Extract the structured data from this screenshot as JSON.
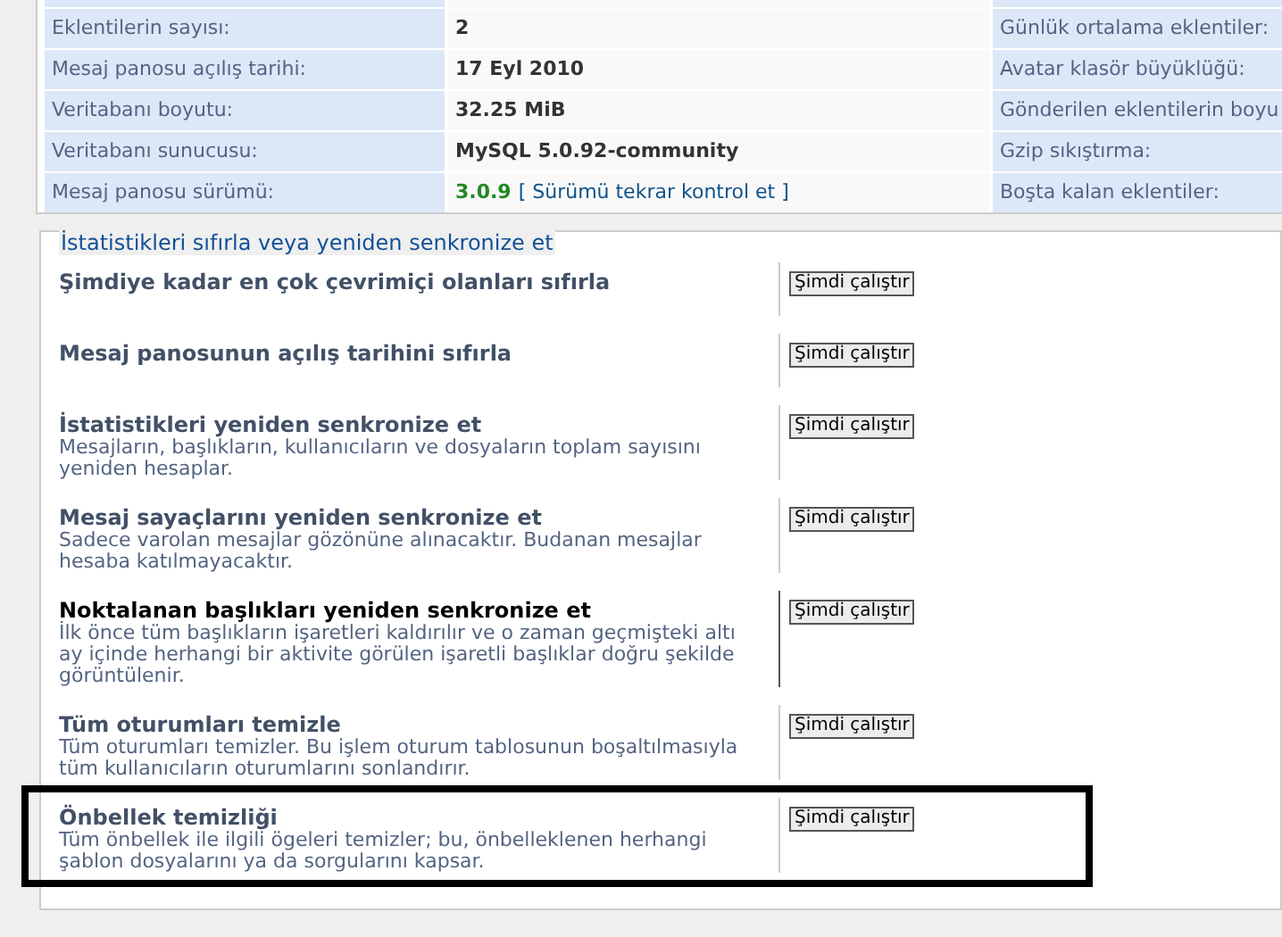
{
  "stats": [
    {
      "label": "Eklentilerin sayısı:",
      "value": "2",
      "kind": "plain",
      "side_label": "Günlük ortalama eklentiler:"
    },
    {
      "label": "Mesaj panosu açılış tarihi:",
      "value": "17 Eyl 2010",
      "kind": "plain",
      "side_label": "Avatar klasör büyüklüğü:"
    },
    {
      "label": "Veritabanı boyutu:",
      "value": "32.25 MiB",
      "kind": "plain",
      "side_label": "Gönderilen eklentilerin boyu"
    },
    {
      "label": "Veritabanı sunucusu:",
      "value": "MySQL 5.0.92-community",
      "kind": "plain",
      "side_label": "Gzip sıkıştırma:"
    },
    {
      "label": "Mesaj panosu sürümü:",
      "value": "3.0.9",
      "kind": "version",
      "link": "[ Sürümü tekrar kontrol et ]",
      "side_label": "Boşta kalan eklentiler:"
    }
  ],
  "section": {
    "legend": "İstatistikleri sıfırla veya yeniden senkronize et",
    "items": [
      {
        "title": "Şimdiye kadar en çok çevrimiçi olanları sıfırla",
        "button": "Şimdi çalıştır",
        "hovered": false,
        "outlined": false
      },
      {
        "title": "Mesaj panosunun açılış tarihini sıfırla",
        "button": "Şimdi çalıştır",
        "hovered": false,
        "outlined": false
      },
      {
        "title": "İstatistikleri yeniden senkronize et",
        "description": "Mesajların, başlıkların, kullanıcıların ve dosyaların toplam sayısını yeniden hesaplar.",
        "button": "Şimdi çalıştır",
        "hovered": false,
        "outlined": false
      },
      {
        "title": "Mesaj sayaçlarını yeniden senkronize et",
        "description": "Sadece varolan mesajlar gözönüne alınacaktır. Budanan mesajlar hesaba katılmayacaktır.",
        "button": "Şimdi çalıştır",
        "hovered": false,
        "outlined": false
      },
      {
        "title": "Noktalanan başlıkları yeniden senkronize et",
        "description": "İlk önce tüm başlıkların işaretleri kaldırılır ve o zaman geçmişteki altı ay içinde herhangi bir aktivite görülen işaretli başlıklar doğru şekilde görüntülenir.",
        "button": "Şimdi çalıştır",
        "hovered": true,
        "outlined": false
      },
      {
        "title": "Tüm oturumları temizle",
        "description": "Tüm oturumları temizler. Bu işlem oturum tablosunun boşaltılmasıyla tüm kullanıcıların oturumlarını sonlandırır.",
        "button": "Şimdi çalıştır",
        "hovered": false,
        "outlined": false
      },
      {
        "title": "Önbellek temizliği",
        "description": "Tüm önbellek ile ilgili ögeleri temizler; bu, önbelleklenen herhangi şablon dosyalarını ya da sorgularını kapsar.",
        "button": "Şimdi çalıştır",
        "hovered": false,
        "outlined": true
      }
    ]
  }
}
